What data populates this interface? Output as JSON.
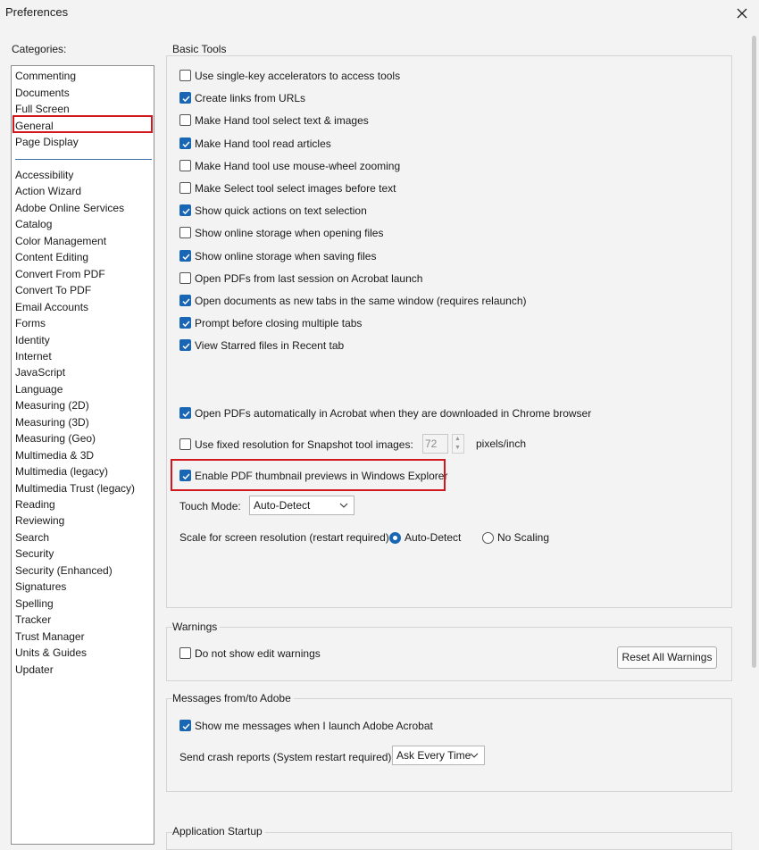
{
  "window": {
    "title": "Preferences"
  },
  "categories": {
    "label": "Categories:",
    "top": [
      "Commenting",
      "Documents",
      "Full Screen",
      "General",
      "Page Display"
    ],
    "selected": "General",
    "rest": [
      "Accessibility",
      "Action Wizard",
      "Adobe Online Services",
      "Catalog",
      "Color Management",
      "Content Editing",
      "Convert From PDF",
      "Convert To PDF",
      "Email Accounts",
      "Forms",
      "Identity",
      "Internet",
      "JavaScript",
      "Language",
      "Measuring (2D)",
      "Measuring (3D)",
      "Measuring (Geo)",
      "Multimedia & 3D",
      "Multimedia (legacy)",
      "Multimedia Trust (legacy)",
      "Reading",
      "Reviewing",
      "Search",
      "Security",
      "Security (Enhanced)",
      "Signatures",
      "Spelling",
      "Tracker",
      "Trust Manager",
      "Units & Guides",
      "Updater"
    ]
  },
  "basic_tools": {
    "title": "Basic Tools",
    "options": [
      {
        "label": "Use single-key accelerators to access tools",
        "checked": false
      },
      {
        "label": "Create links from URLs",
        "checked": true
      },
      {
        "label": "Make Hand tool select text & images",
        "checked": false
      },
      {
        "label": "Make Hand tool read articles",
        "checked": true
      },
      {
        "label": "Make Hand tool use mouse-wheel zooming",
        "checked": false
      },
      {
        "label": "Make Select tool select images before text",
        "checked": false
      },
      {
        "label": "Show quick actions on text selection",
        "checked": true
      },
      {
        "label": "Show online storage when opening files",
        "checked": false
      },
      {
        "label": "Show online storage when saving files",
        "checked": true
      },
      {
        "label": "Open PDFs from last session on Acrobat launch",
        "checked": false
      },
      {
        "label": "Open documents as new tabs in the same window (requires relaunch)",
        "checked": true
      },
      {
        "label": "Prompt before closing multiple tabs",
        "checked": true
      },
      {
        "label": "View Starred files in Recent tab",
        "checked": true
      }
    ],
    "chrome_option": {
      "label": "Open PDFs automatically in Acrobat when they are downloaded in Chrome browser",
      "checked": true
    },
    "fixed_resolution": {
      "label": "Use fixed resolution for Snapshot tool images:",
      "checked": false,
      "value": "72",
      "unit": "pixels/inch"
    },
    "thumbnail_option": {
      "label": "Enable PDF thumbnail previews in Windows Explorer",
      "checked": true
    },
    "touch_mode": {
      "label": "Touch Mode:",
      "value": "Auto-Detect"
    },
    "scale": {
      "label": "Scale for screen resolution (restart required):",
      "option_auto": "Auto-Detect",
      "option_none": "No Scaling",
      "selected": "Auto-Detect"
    }
  },
  "warnings": {
    "title": "Warnings",
    "option": {
      "label": "Do not show edit warnings",
      "checked": false
    },
    "reset_button": "Reset All Warnings"
  },
  "messages": {
    "title": "Messages from/to Adobe",
    "option": {
      "label": "Show me messages when I launch Adobe Acrobat",
      "checked": true
    },
    "crash_label": "Send crash reports (System restart required):",
    "crash_value": "Ask Every Time"
  },
  "startup": {
    "title": "Application Startup"
  },
  "colors": {
    "accent": "#1866b4",
    "highlight": "#d0181e"
  }
}
